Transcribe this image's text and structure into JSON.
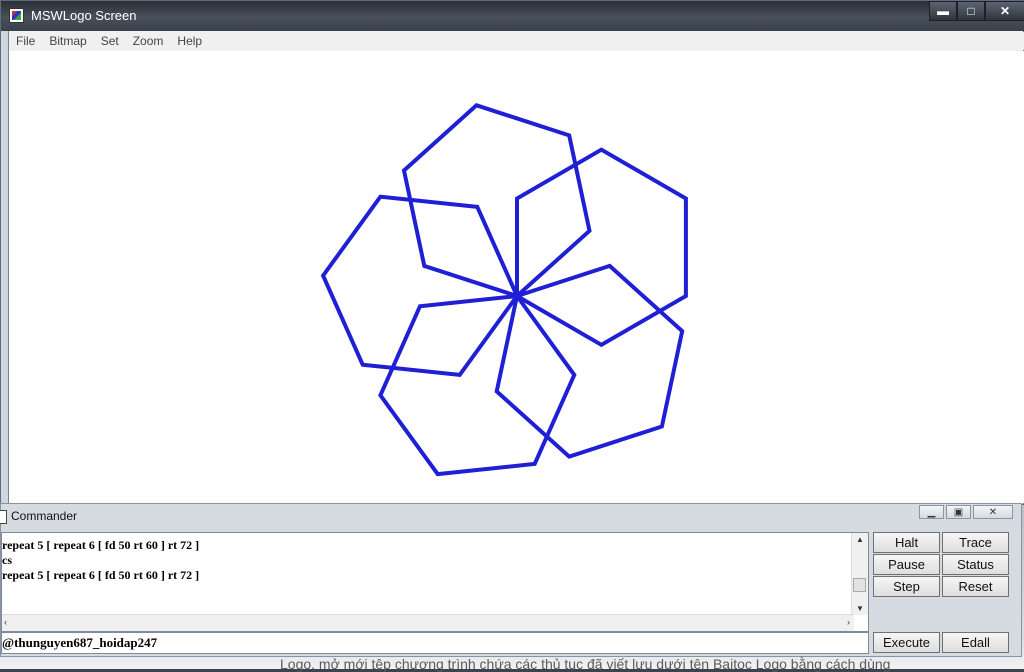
{
  "window": {
    "title": "MSWLogo Screen"
  },
  "caption_buttons": {
    "minimize": "▬",
    "maximize": "□",
    "close": "✕"
  },
  "menu": [
    "File",
    "Bitmap",
    "Set",
    "Zoom",
    "Help"
  ],
  "drawing": {
    "stroke_color": "#1f1fd6",
    "petals": 5,
    "sides": 6,
    "side_length": 50,
    "turn_per_side": 60,
    "turn_per_petal": 72
  },
  "commander": {
    "title": "Commander",
    "history": [
      "repeat 5 [ repeat 6 [ fd 50 rt 60 ] rt 72 ]",
      "cs",
      "repeat 5 [ repeat 6 [ fd 50 rt 60 ] rt 72 ]"
    ],
    "input_value": "@thunguyen687_hoidap247",
    "buttons": {
      "halt": "Halt",
      "trace": "Trace",
      "pause": "Pause",
      "status": "Status",
      "step": "Step",
      "reset": "Reset",
      "execute": "Execute",
      "edall": "Edall"
    }
  },
  "footer": {
    "text": "Logo, mở mới tệp chương trình chứa các thủ tục đã viết lưu dưới tên Baitoc Logo bằng cách dùng"
  }
}
